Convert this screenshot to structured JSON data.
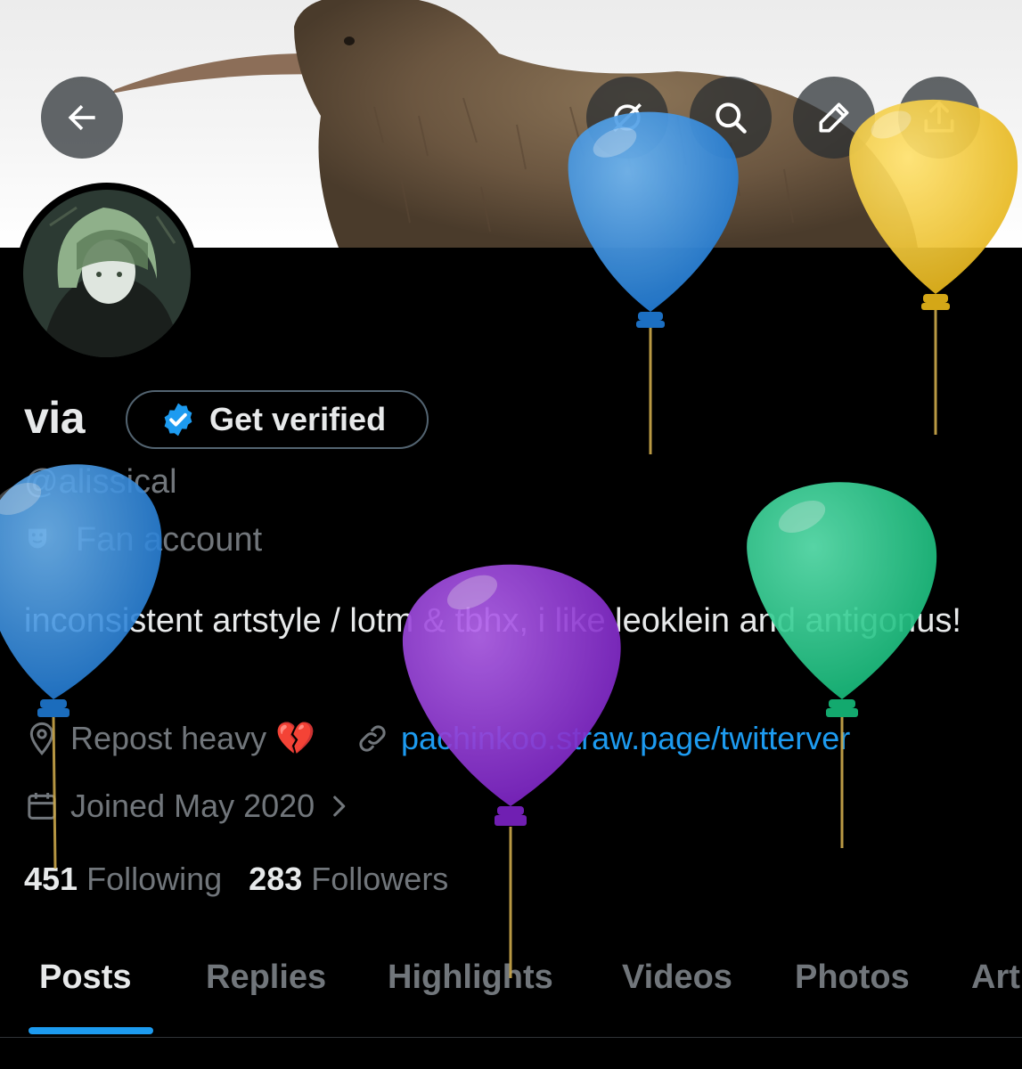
{
  "header": {
    "icons": [
      "back-arrow-icon",
      "grok-icon",
      "search-icon",
      "edit-icon",
      "share-icon"
    ]
  },
  "profile": {
    "display_name": "via",
    "get_verified_label": "Get verified",
    "handle": "@alissical",
    "category": "Fan account",
    "bio": "inconsistent artstyle / lotm & tbhx, i like leoklein and antigonus!",
    "location": "Repost heavy 💔",
    "website": "pachinkoo.straw.page/twitterver",
    "joined": "Joined May 2020",
    "following_count": "451",
    "following_label": "Following",
    "followers_count": "283",
    "followers_label": "Followers"
  },
  "tabs": [
    {
      "label": "Posts"
    },
    {
      "label": "Replies"
    },
    {
      "label": "Highlights"
    },
    {
      "label": "Videos"
    },
    {
      "label": "Photos"
    },
    {
      "label": "Art"
    }
  ],
  "colors": {
    "accent": "#1d9bf0",
    "background": "#000000",
    "muted_text": "#71767b",
    "balloon_blue": "#3a94e0",
    "balloon_yellow": "#f5c832",
    "balloon_purple": "#9a3fd6",
    "balloon_green": "#2fd497"
  }
}
